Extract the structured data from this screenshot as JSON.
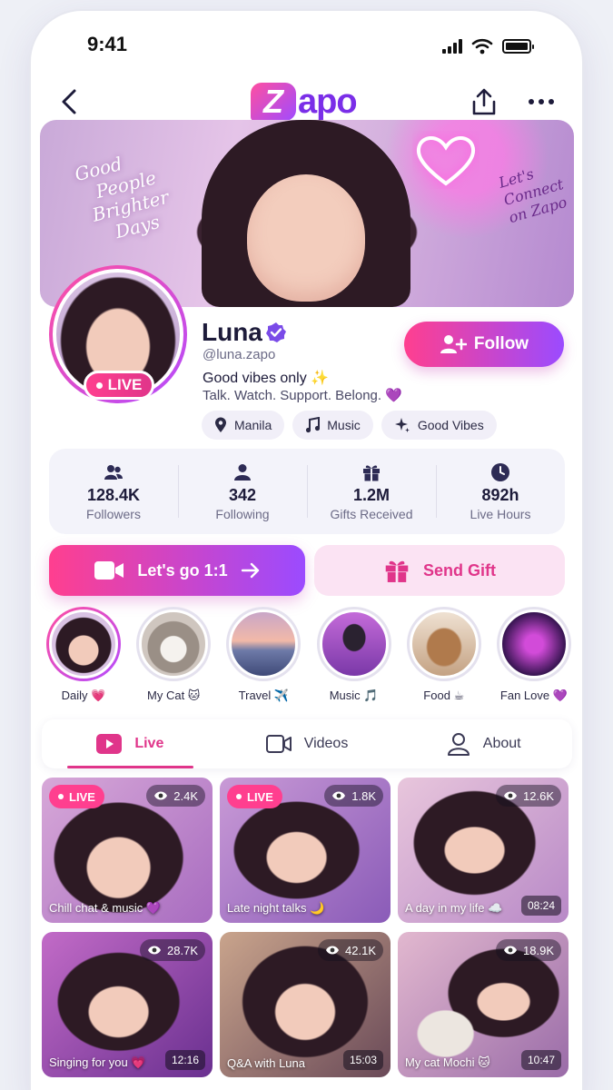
{
  "status": {
    "time": "9:41"
  },
  "brand": {
    "logo_letter": "Z",
    "logo_rest": "apo"
  },
  "banner": {
    "quote_left": [
      "Good",
      "People",
      "Brighter",
      "Days"
    ],
    "quote_right": [
      "Let's",
      "Connect",
      "on Zapo"
    ]
  },
  "profile": {
    "name": "Luna",
    "handle": "@luna.zapo",
    "live_label": "LIVE",
    "bio_line1": "Good vibes only ✨",
    "bio_line2": "Talk. Watch. Support. Belong. 💜",
    "follow_label": "Follow",
    "chips": [
      {
        "label": "Manila",
        "icon": "location-pin-icon"
      },
      {
        "label": "Music",
        "icon": "music-note-icon"
      },
      {
        "label": "Good Vibes",
        "icon": "sparkle-icon"
      }
    ]
  },
  "stats": [
    {
      "value": "128.4K",
      "label": "Followers",
      "icon": "users-icon"
    },
    {
      "value": "342",
      "label": "Following",
      "icon": "user-icon"
    },
    {
      "value": "1.2M",
      "label": "Gifts Received",
      "icon": "gift-icon"
    },
    {
      "value": "892h",
      "label": "Live Hours",
      "icon": "clock-icon"
    }
  ],
  "actions": {
    "call_label": "Let's go 1:1",
    "gift_label": "Send Gift"
  },
  "highlights": [
    {
      "label": "Daily 💗"
    },
    {
      "label": "My Cat 🐱"
    },
    {
      "label": "Travel ✈️"
    },
    {
      "label": "Music 🎵"
    },
    {
      "label": "Food ☕"
    },
    {
      "label": "Fan Love 💜"
    }
  ],
  "tabs": [
    {
      "label": "Live",
      "icon": "play-icon",
      "active": true
    },
    {
      "label": "Videos",
      "icon": "video-camera-icon",
      "active": false
    },
    {
      "label": "About",
      "icon": "person-icon",
      "active": false
    }
  ],
  "cards": [
    {
      "live": "LIVE",
      "views": "2.4K",
      "title": "Chill chat & music 💜",
      "duration": ""
    },
    {
      "live": "LIVE",
      "views": "1.8K",
      "title": "Late night talks 🌙",
      "duration": ""
    },
    {
      "live": "",
      "views": "12.6K",
      "title": "A day in my life ☁️",
      "duration": "08:24"
    },
    {
      "live": "",
      "views": "28.7K",
      "title": "Singing for you 💗",
      "duration": "12:16"
    },
    {
      "live": "",
      "views": "42.1K",
      "title": "Q&A with Luna",
      "duration": "15:03"
    },
    {
      "live": "",
      "views": "18.9K",
      "title": "My cat Mochi 🐱",
      "duration": "10:47"
    }
  ],
  "colors": {
    "accent_pink": "#ff3f8f",
    "accent_purple": "#9b4bff",
    "text_dark": "#1d1b3a"
  }
}
